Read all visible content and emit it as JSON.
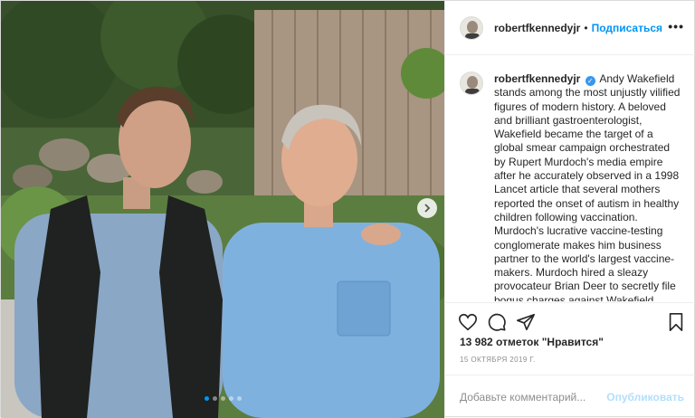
{
  "post": {
    "photo": {
      "alt_icon": "photo-carousel",
      "current_slide": 1,
      "slide_count": 5
    },
    "header": {
      "username": "robertfkennedyjr",
      "separator": "•",
      "follow_label": "Подписаться",
      "more_label": "•••"
    },
    "caption": {
      "username": "robertfkennedyjr",
      "verified_mark": "✓",
      "text": "Andy Wakefield stands among the most unjustly vilified figures of modern history. A beloved and brilliant gastroenterologist, Wakefield became the target of a global smear campaign orchestrated by Rupert Murdoch's media empire after he accurately observed in a 1998 Lancet article that several mothers reported the onset of autism in healthy children following vaccination. Murdoch's lucrative vaccine-testing conglomerate makes him business partner to the world's largest vaccine-makers. Murdoch hired a sleazy provocateur Brian Deer to secretly file bogus charges against Wakefield"
    },
    "actions": {
      "like_icon": "heart-icon",
      "comment_icon": "comment-icon",
      "share_icon": "paper-plane-icon",
      "save_icon": "bookmark-icon"
    },
    "likes": "13 982 отметок \"Нравится\"",
    "date": "15 ОКТЯБРЯ 2019 Г.",
    "comment": {
      "placeholder": "Добавьте комментарий...",
      "publish_label": "Опубликовать"
    },
    "colors": {
      "accent": "#0095f6",
      "publish_disabled": "#b2dffc",
      "verified": "#3897f0"
    }
  }
}
